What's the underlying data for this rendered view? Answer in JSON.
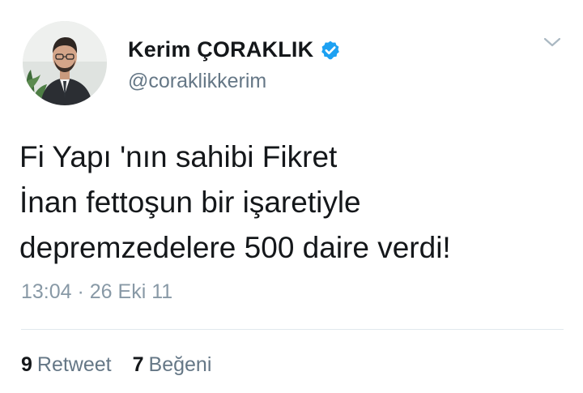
{
  "author": {
    "display_name": "Kerim ÇORAKLIK",
    "handle": "@coraklikkerim",
    "verified": true,
    "verified_color": "#1da1f2"
  },
  "icons": {
    "verified": "verified-badge-icon",
    "caret": "chevron-down-icon",
    "avatar": "profile-photo"
  },
  "tweet": {
    "lines": [
      "Fi Yapı 'nın sahibi Fikret",
      "İnan fettoşun bir işaretiyle",
      "depremzedelere 500 daire verdi!"
    ],
    "timestamp": "13:04 · 26 Eki 11"
  },
  "stats": {
    "retweet_count": "9",
    "retweet_label": "Retweet",
    "like_count": "7",
    "like_label": "Beğeni"
  }
}
